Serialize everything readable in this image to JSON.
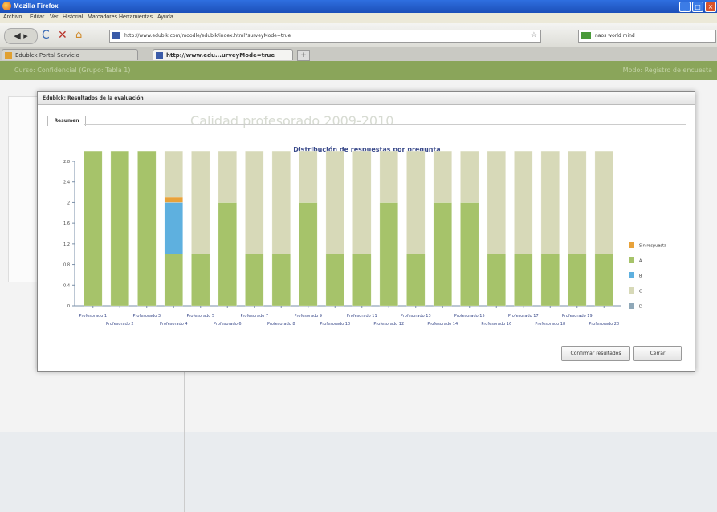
{
  "window": {
    "title": "Mozilla Firefox"
  },
  "menu": [
    "Archivo",
    "Editar",
    "Ver",
    "Historial",
    "Marcadores",
    "Herramientas",
    "Ayuda"
  ],
  "nav": {
    "url": "http://www.edublk.com/moodle/edublk/index.html?surveyMode=true",
    "search": "naos world mind"
  },
  "tabs": [
    {
      "label": "Edublck Portal Servicio"
    },
    {
      "label": "http://www.edu...urveyMode=true"
    }
  ],
  "page": {
    "header_left": "Curso: Confidencial (Grupo: Tabla 1)",
    "header_right": "Modo: Registro de encuesta",
    "bg_title": "Calidad profesorado 2009-2010"
  },
  "dialog": {
    "title": "Edublck: Resultados de la evaluación",
    "tab": "Resumen",
    "confirm_label": "Confirmar resultados",
    "close_label": "Cerrar"
  },
  "colors": {
    "sin_respuesta": "#e8a23a",
    "A": "#a6c36a",
    "B": "#5eb0df",
    "C": "#d7d9b8",
    "D": "#8fa8b8"
  },
  "chart_data": {
    "type": "bar",
    "stacked": true,
    "title": "Distribución de respuestas por pregunta",
    "ylim": [
      0,
      2.8
    ],
    "yticks": [
      "0",
      "0.4",
      "0.8",
      "1.2",
      "1.6",
      "2",
      "2.4",
      "2.8"
    ],
    "ytick_values": [
      0,
      0.4,
      0.8,
      1.2,
      1.6,
      2.0,
      2.4,
      2.8
    ],
    "legend_position": "right",
    "categories": [
      "Profesorado 1",
      "Profesorado 2",
      "Profesorado 3",
      "Profesorado 4",
      "Profesorado 5",
      "Profesorado 6",
      "Profesorado 7",
      "Profesorado 8",
      "Profesorado 9",
      "Profesorado 10",
      "Profesorado 11",
      "Profesorado 12",
      "Profesorado 13",
      "Profesorado 14",
      "Profesorado 15",
      "Profesorado 16",
      "Profesorado 17",
      "Profesorado 18",
      "Profesorado 19",
      "Profesorado 20"
    ],
    "series": [
      {
        "name": "Sin respuesta",
        "values": [
          0,
          0,
          0,
          0.1,
          0,
          0,
          0,
          0,
          0,
          0,
          0,
          0,
          0,
          0,
          0,
          0,
          0,
          0,
          0,
          0
        ]
      },
      {
        "name": "A",
        "values": [
          3,
          3,
          3,
          1,
          1,
          2,
          1,
          1,
          2,
          1,
          1,
          2,
          1,
          2,
          2,
          1,
          1,
          1,
          1,
          1
        ]
      },
      {
        "name": "B",
        "values": [
          0,
          0,
          0,
          1,
          0,
          0,
          0,
          0,
          0,
          0,
          0,
          0,
          0,
          0,
          0,
          0,
          0,
          0,
          0,
          0
        ]
      },
      {
        "name": "C",
        "values": [
          0,
          0,
          0,
          0.9,
          2,
          1,
          2,
          2,
          1,
          2,
          2,
          1,
          2,
          1,
          1,
          2,
          2,
          2,
          2,
          2
        ]
      },
      {
        "name": "D",
        "values": [
          0,
          0,
          0,
          0,
          0,
          0,
          0,
          0,
          0,
          0,
          0,
          0,
          0,
          0,
          0,
          0,
          0,
          0,
          0,
          0
        ]
      }
    ]
  }
}
